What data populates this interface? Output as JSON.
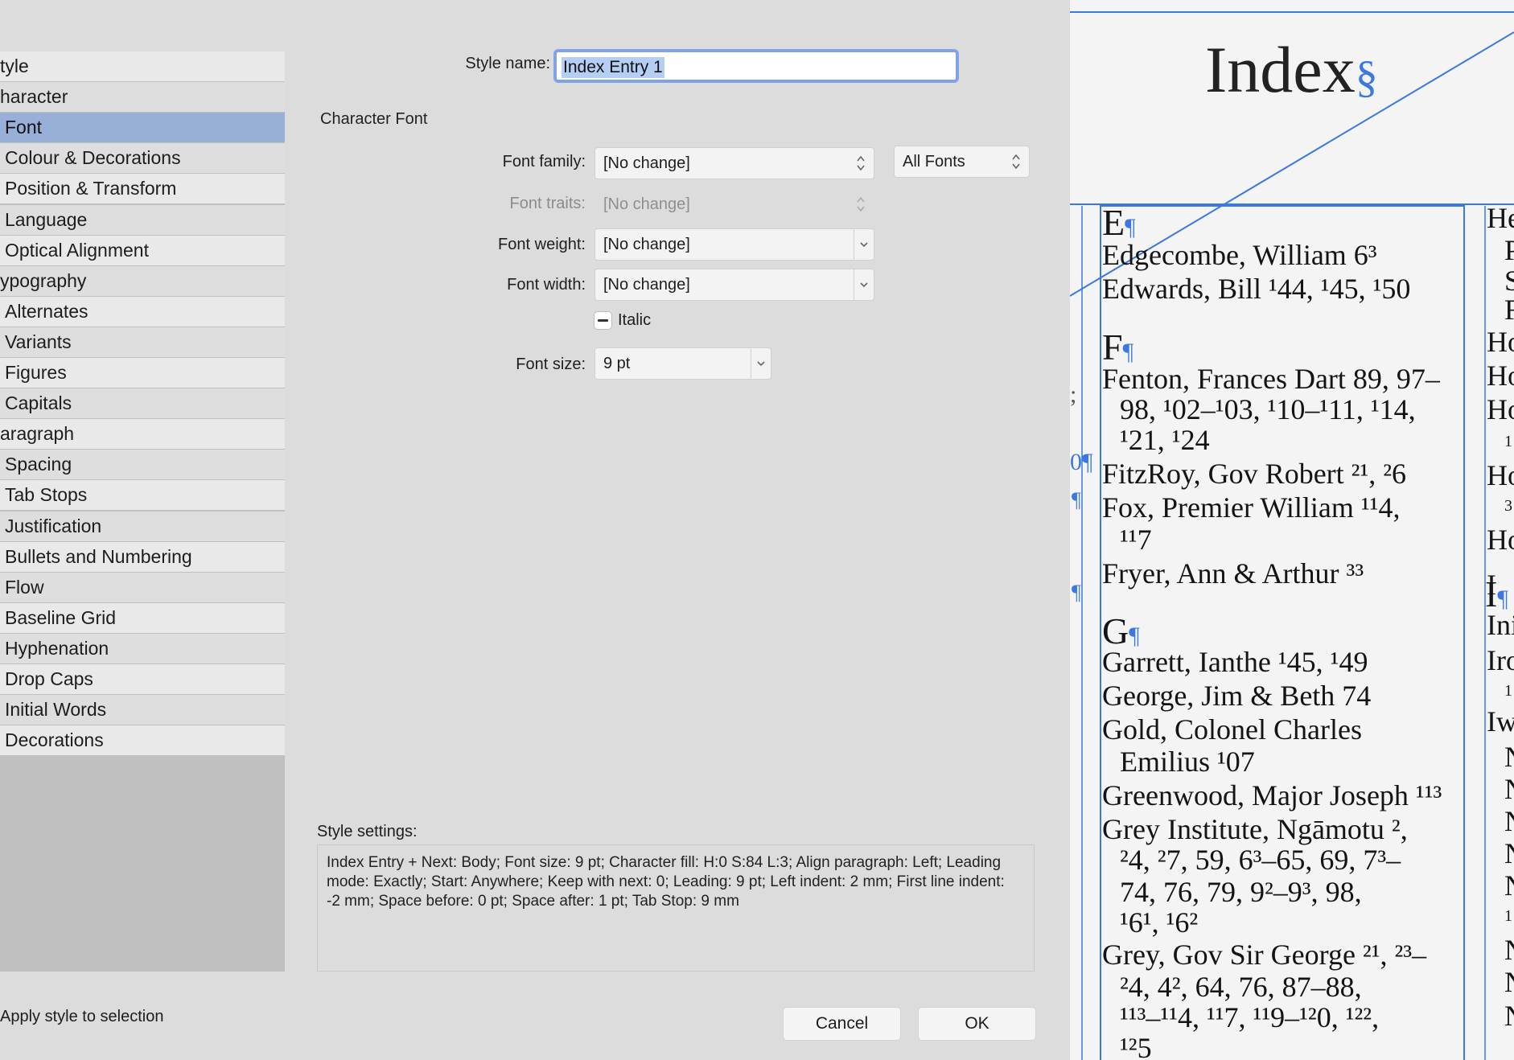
{
  "dialog": {
    "style_name_label": "Style name:",
    "style_name_value": "Index Entry 1",
    "section_title": "Character Font",
    "font_family_label": "Font family:",
    "font_family_value": "[No change]",
    "font_filter_value": "All Fonts",
    "font_traits_label": "Font traits:",
    "font_traits_value": "[No change]",
    "font_weight_label": "Font weight:",
    "font_weight_value": "[No change]",
    "font_width_label": "Font width:",
    "font_width_value": "[No change]",
    "italic_label": "Italic",
    "font_size_label": "Font size:",
    "font_size_value": "9 pt",
    "settings_label": "Style settings:",
    "settings_text": "Index Entry + Next: Body; Font size: 9 pt; Character fill: H:0 S:84 L:3; Align paragraph: Left; Leading mode: Exactly; Start: Anywhere; Keep with next: 0; Leading: 9 pt; Left indent: 2 mm; First line indent: -2 mm; Space before: 0 pt; Space after: 1 pt; Tab Stop: 9 mm",
    "apply_label": "Apply style to selection",
    "cancel_label": "Cancel",
    "ok_label": "OK"
  },
  "sidebar": {
    "items": [
      {
        "label": "tyle",
        "selected": false
      },
      {
        "label": "haracter",
        "selected": false
      },
      {
        "label": "Font",
        "selected": true
      },
      {
        "label": "Colour & Decorations",
        "selected": false
      },
      {
        "label": "Position & Transform",
        "selected": false
      },
      {
        "label": "Language",
        "selected": false
      },
      {
        "label": "Optical Alignment",
        "selected": false
      },
      {
        "label": "ypography",
        "selected": false
      },
      {
        "label": "Alternates",
        "selected": false
      },
      {
        "label": "Variants",
        "selected": false
      },
      {
        "label": "Figures",
        "selected": false
      },
      {
        "label": "Capitals",
        "selected": false
      },
      {
        "label": "aragraph",
        "selected": false
      },
      {
        "label": "Spacing",
        "selected": false
      },
      {
        "label": "Tab Stops",
        "selected": false
      },
      {
        "label": "Justification",
        "selected": false
      },
      {
        "label": "Bullets and Numbering",
        "selected": false
      },
      {
        "label": "Flow",
        "selected": false
      },
      {
        "label": "Baseline Grid",
        "selected": false
      },
      {
        "label": "Hyphenation",
        "selected": false
      },
      {
        "label": "Drop Caps",
        "selected": false
      },
      {
        "label": "Initial Words",
        "selected": false
      },
      {
        "label": "Decorations",
        "selected": false
      }
    ]
  },
  "document": {
    "heading": "Index",
    "pilcrow": "¶",
    "section_mark": "§",
    "letters": [
      "E",
      "F",
      "G",
      "I"
    ],
    "entries": [
      "Edgecombe, William  6³",
      "Edwards, Bill  ¹44, ¹45, ¹50",
      "Fenton, Frances Dart  89, 97–",
      "98, ¹02–¹03, ¹10–¹11, ¹14,",
      "¹21, ¹24",
      "FitzRoy, Gov Robert  ²¹, ²6",
      "Fox, Premier William  ¹¹4,",
      "¹¹7",
      "Fryer, Ann & Arthur  ³³",
      "Garrett, Ianthe  ¹45, ¹49",
      "George, Jim & Beth  74",
      "Gold, Colonel Charles",
      "Emilius  ¹07",
      "Greenwood, Major Joseph  ¹¹³",
      "Grey Institute, Ngāmotu  ², ",
      "²4, ²7, 59, 6³–65, 69, 7³–",
      "74, 76, 79, 9²–9³, 98,",
      "¹6¹, ¹6²",
      "Grey, Gov Sir George  ²¹, ²³–",
      "²4, 4², 64, 76, 87–88,",
      "¹¹³–¹¹4, ¹¹7, ¹¹9–¹²0, ¹²²,",
      "¹²5"
    ],
    "right_col": [
      "He",
      "P",
      "S",
      "F",
      "Ho",
      "Ho",
      "Ho",
      "1",
      "Ho",
      "3",
      "Ho",
      "I",
      "Ini",
      "Iro",
      "1",
      "Iw",
      "N",
      "N",
      "N",
      "N",
      "N",
      "1",
      "N",
      "N",
      "N"
    ]
  },
  "colors": {
    "selection": "#98afd7",
    "guide_blue": "#3b78e0",
    "focus_ring": "#7fa3e6"
  }
}
